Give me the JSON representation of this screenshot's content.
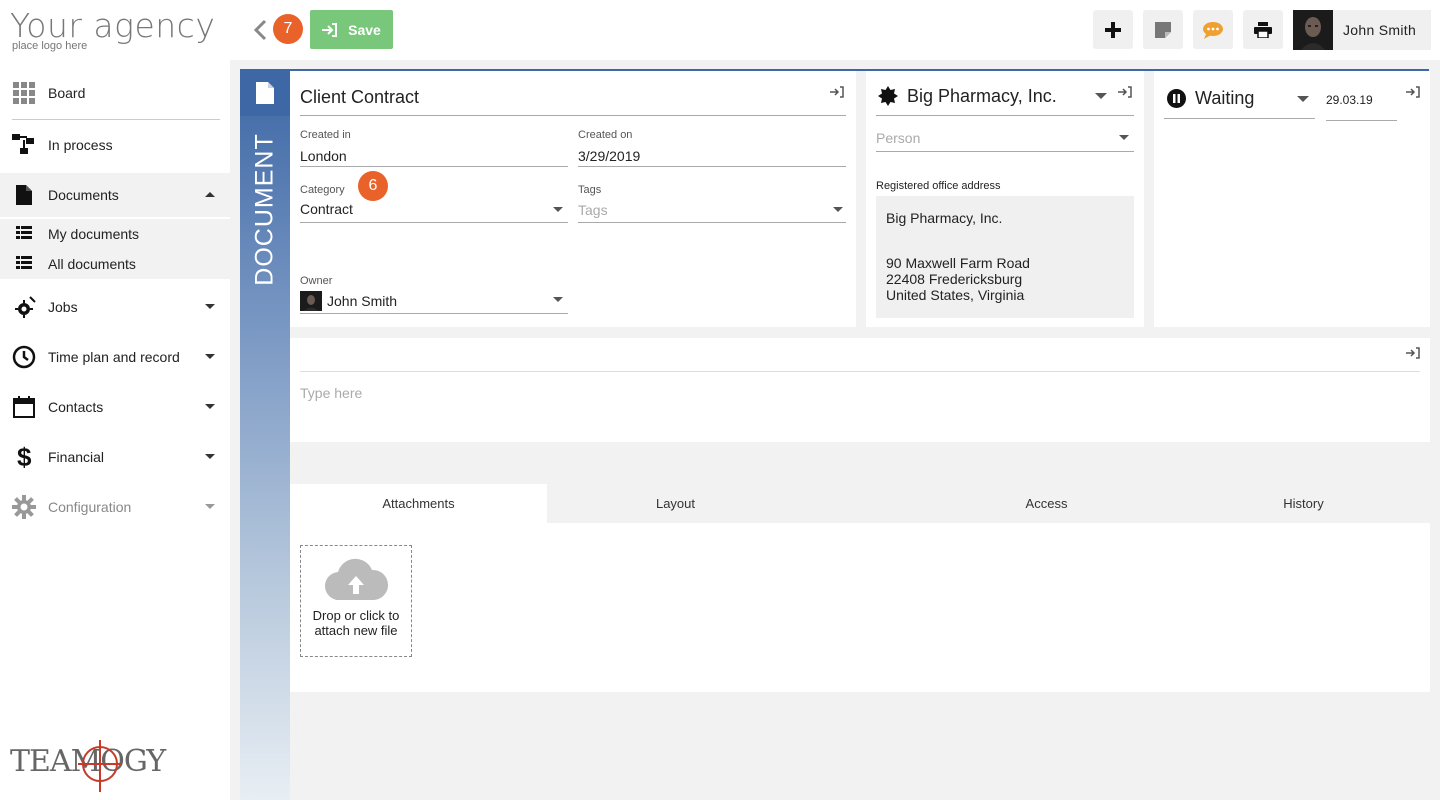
{
  "logo": {
    "title": "Your agency",
    "subtitle": "place logo here"
  },
  "nav": {
    "board": "Board",
    "in_process": "In process",
    "documents": "Documents",
    "my_documents": "My documents",
    "all_documents": "All documents",
    "jobs": "Jobs",
    "time_plan": "Time plan and record",
    "contacts": "Contacts",
    "financial": "Financial",
    "configuration": "Configuration"
  },
  "brand_footer": "TEAMOGY",
  "toolbar": {
    "back_badge": "7",
    "save_label": "Save",
    "user_name": "John Smith"
  },
  "doc_strip_label": "DOCUMENT",
  "main": {
    "title": "Client Contract",
    "created_in_label": "Created in",
    "created_in": "London",
    "created_on_label": "Created on",
    "created_on": "3/29/2019",
    "category_label": "Category",
    "category": "Contract",
    "category_badge": "6",
    "tags_label": "Tags",
    "tags_placeholder": "Tags",
    "owner_label": "Owner",
    "owner": "John Smith"
  },
  "company": {
    "name": "Big Pharmacy, Inc.",
    "person_placeholder": "Person",
    "address_label": "Registered office address",
    "address_line1": "Big Pharmacy, Inc.",
    "address_line2": "90  Maxwell Farm Road",
    "address_line3": "22408 Fredericksburg",
    "address_line4": "United States, Virginia"
  },
  "status": {
    "state": "Waiting",
    "date": "29.03.19"
  },
  "notes": {
    "placeholder": "Type here"
  },
  "tabs": [
    "Attachments",
    "Layout",
    "Access",
    "History"
  ],
  "dropzone": {
    "line1": "Drop or click to",
    "line2": "attach new file"
  },
  "colors": {
    "accent": "#3d67a5",
    "save": "#78c77a",
    "badge": "#e8622a",
    "chat": "#f0a030"
  }
}
